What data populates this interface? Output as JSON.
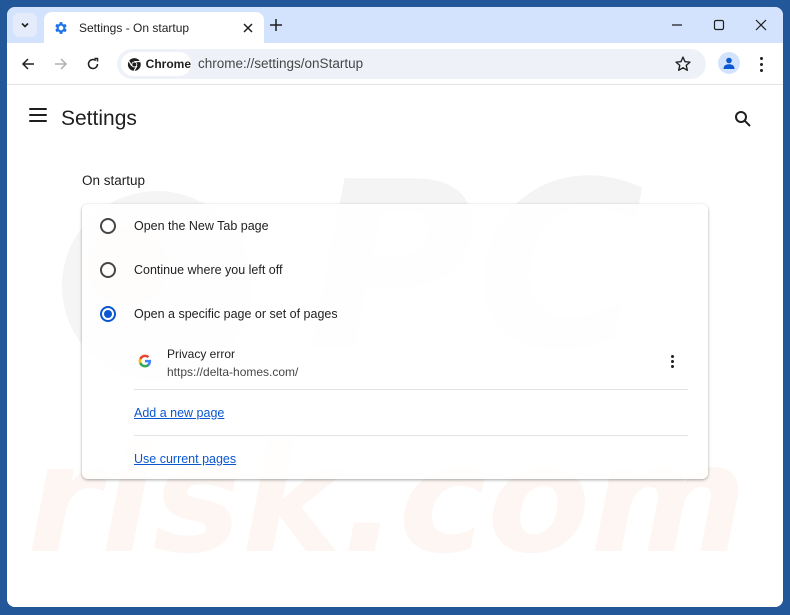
{
  "browser": {
    "tab": {
      "title": "Settings - On startup",
      "icon": "settings-gear-icon"
    },
    "omnibox": {
      "chip_label": "Chrome",
      "url": "chrome://settings/onStartup"
    },
    "colors": {
      "frame": "#22579a",
      "titlebar": "#d3e3fd",
      "accent": "#0b57d0"
    }
  },
  "settings": {
    "title": "Settings",
    "section_title": "On startup",
    "options": [
      {
        "label": "Open the New Tab page",
        "checked": false
      },
      {
        "label": "Continue where you left off",
        "checked": false
      },
      {
        "label": "Open a specific page or set of pages",
        "checked": true
      }
    ],
    "pages": [
      {
        "title": "Privacy error",
        "url": "https://delta-homes.com/",
        "favicon": "google-g-icon"
      }
    ],
    "add_page_label": "Add a new page",
    "use_current_label": "Use current pages"
  },
  "watermark": {
    "text_top": "PC",
    "text_bottom": "risk.com"
  }
}
